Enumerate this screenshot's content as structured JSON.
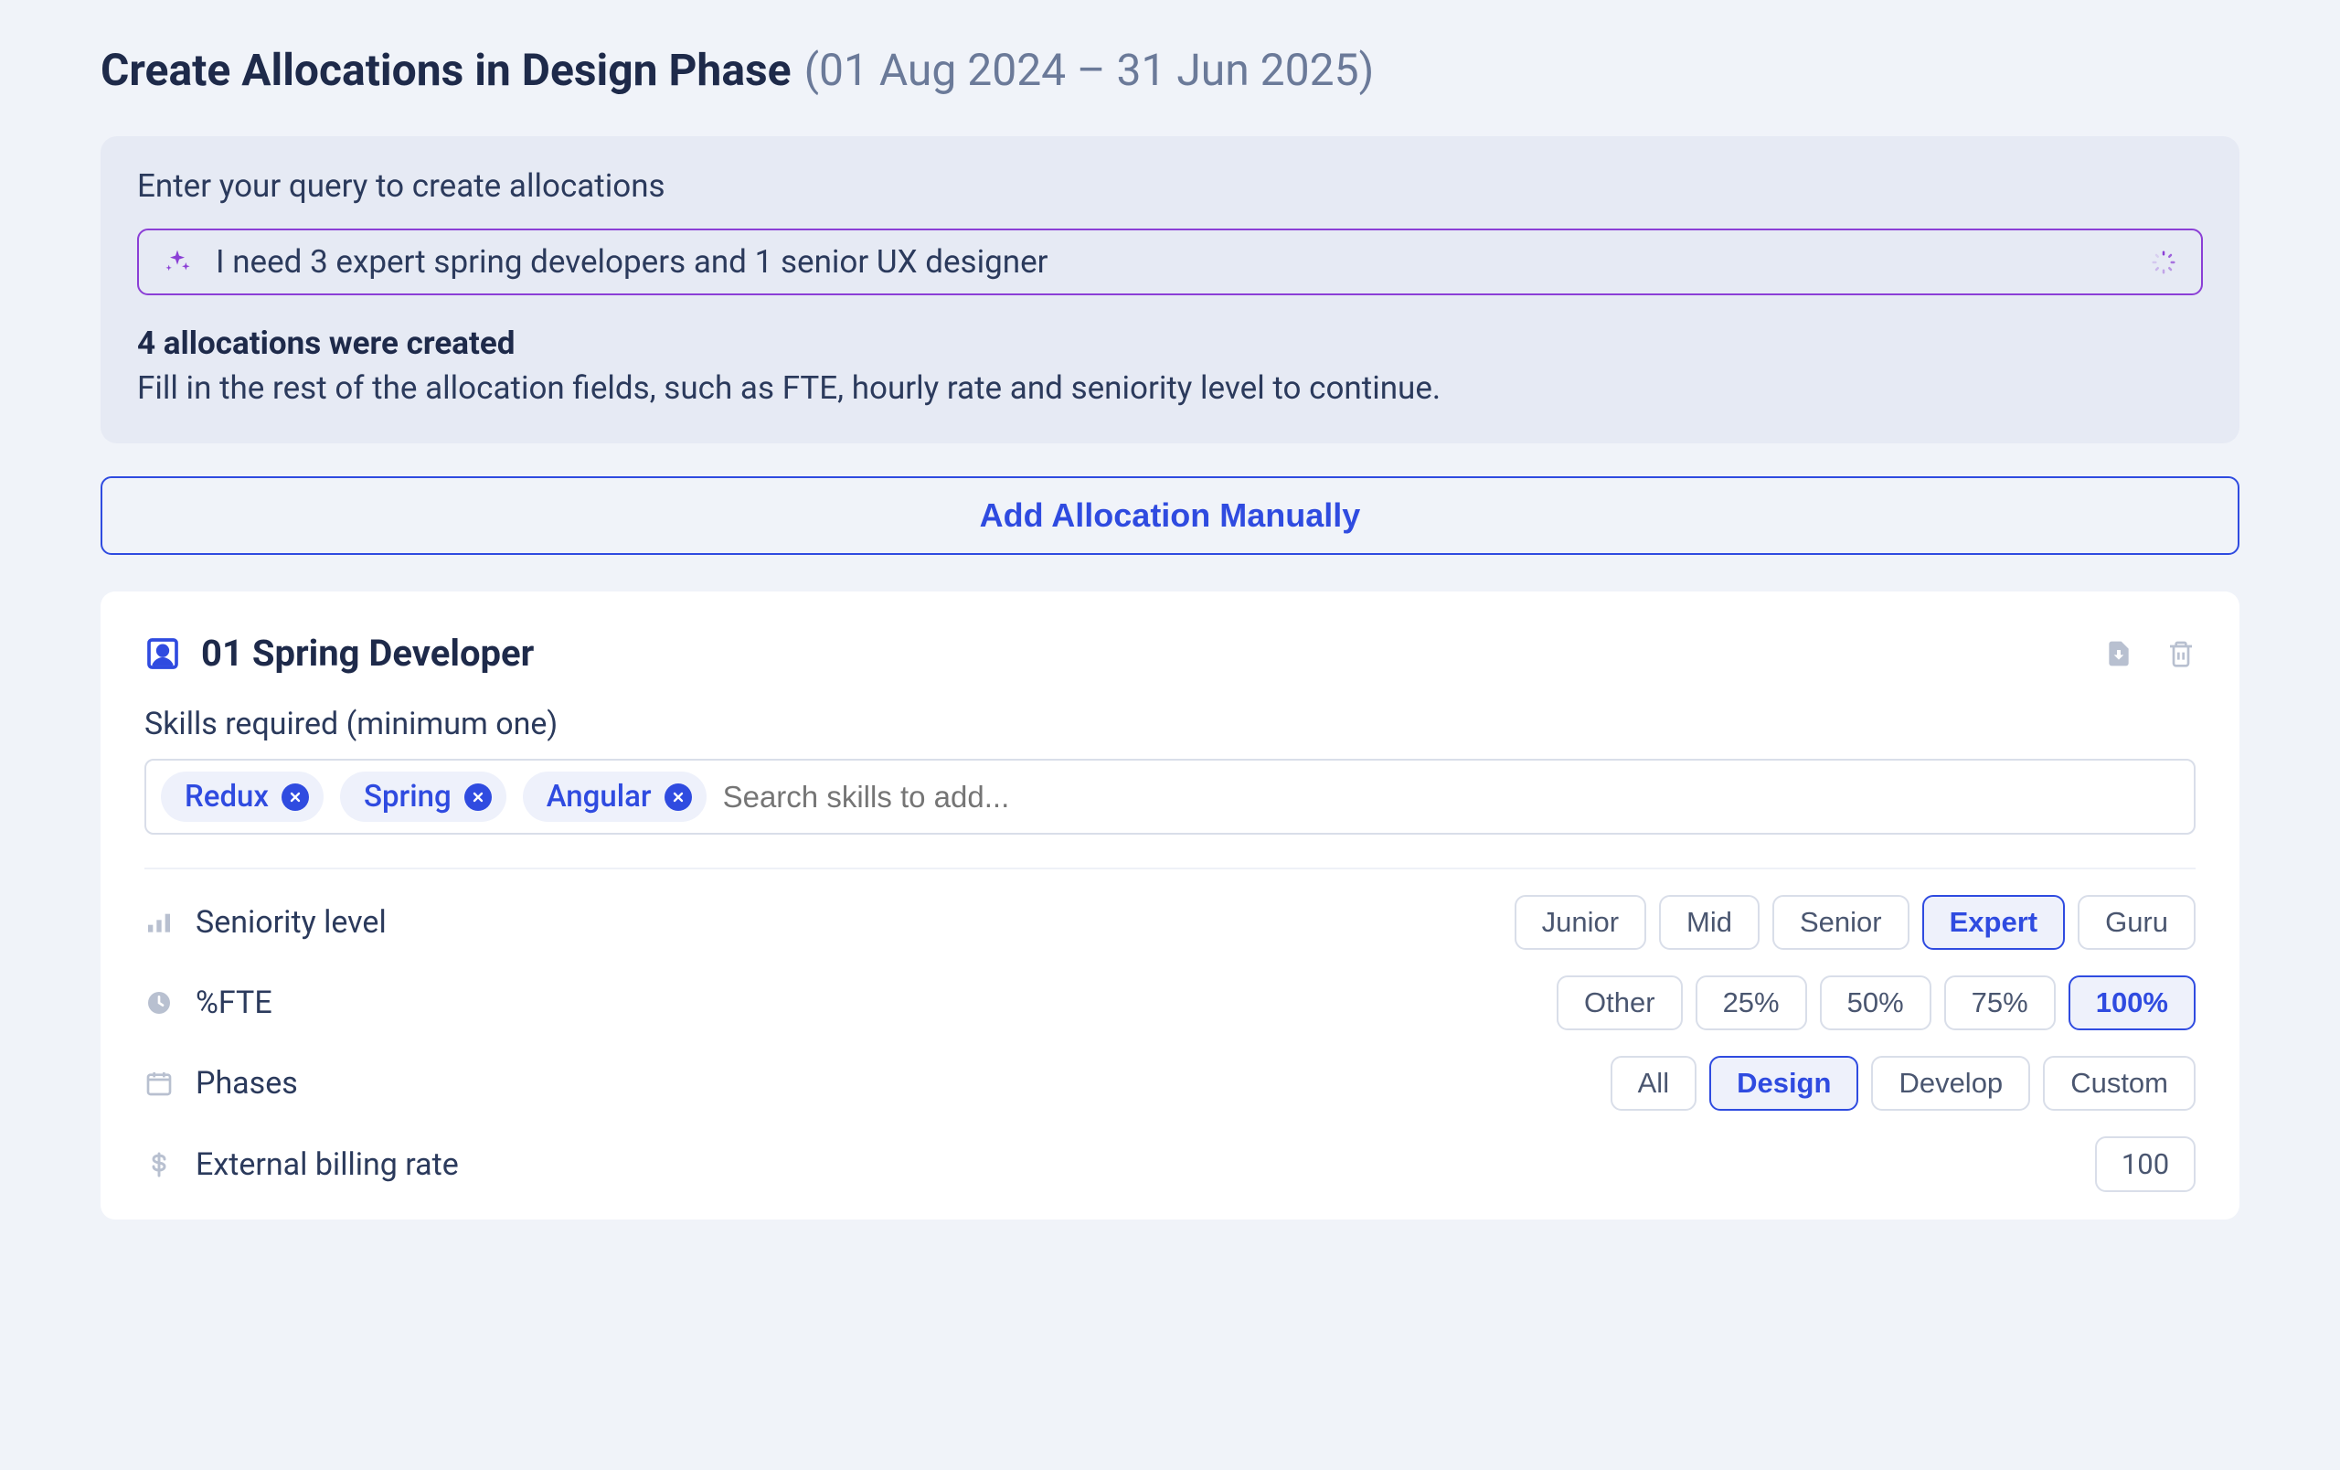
{
  "header": {
    "title": "Create Allocations in Design Phase",
    "date_range": "(01 Aug 2024 – 31 Jun 2025)"
  },
  "query_panel": {
    "label": "Enter your query to create allocations",
    "query_text": "I need 3 expert spring developers and 1 senior UX designer",
    "result_heading": "4 allocations were created",
    "result_sub": "Fill in the rest of the allocation fields, such as FTE, hourly rate and seniority level to continue."
  },
  "add_manual_label": "Add Allocation Manually",
  "allocation": {
    "title": "01 Spring Developer",
    "skills_label": "Skills required (minimum one)",
    "skills": [
      "Redux",
      "Spring",
      "Angular"
    ],
    "skills_placeholder": "Search skills to add...",
    "fields": {
      "seniority": {
        "label": "Seniority level",
        "options": [
          "Junior",
          "Mid",
          "Senior",
          "Expert",
          "Guru"
        ],
        "selected": "Expert"
      },
      "fte": {
        "label": "%FTE",
        "options": [
          "Other",
          "25%",
          "50%",
          "75%",
          "100%"
        ],
        "selected": "100%"
      },
      "phases": {
        "label": "Phases",
        "options": [
          "All",
          "Design",
          "Develop",
          "Custom"
        ],
        "selected": "Design"
      },
      "billing": {
        "label": "External billing rate",
        "value": "100"
      }
    }
  }
}
